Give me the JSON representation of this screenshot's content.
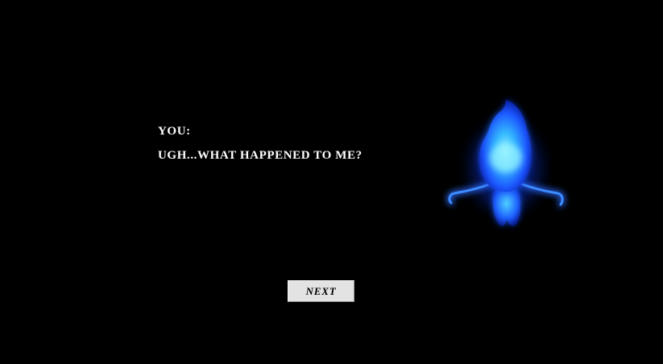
{
  "dialogue": {
    "speaker": "You:",
    "line": "Ugh...what happened to me?"
  },
  "controls": {
    "next_label": "Next"
  },
  "character": {
    "icon": "blue-flame-spirit-icon",
    "glow_color": "#1a5cff",
    "core_color": "#5fe0ff"
  }
}
